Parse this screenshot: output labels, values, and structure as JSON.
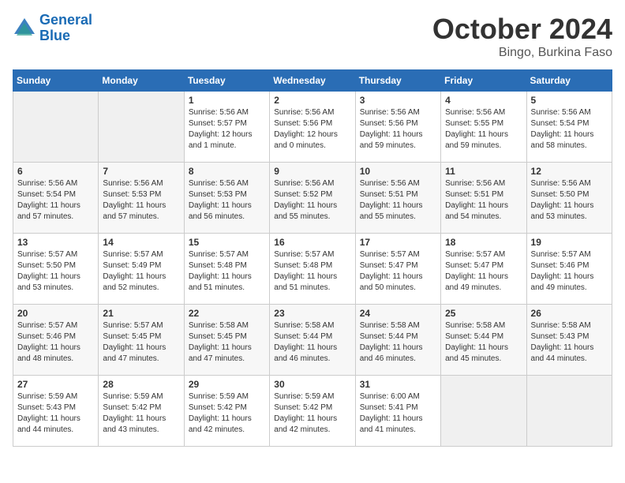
{
  "header": {
    "logo_line1": "General",
    "logo_line2": "Blue",
    "month": "October 2024",
    "location": "Bingo, Burkina Faso"
  },
  "weekdays": [
    "Sunday",
    "Monday",
    "Tuesday",
    "Wednesday",
    "Thursday",
    "Friday",
    "Saturday"
  ],
  "weeks": [
    [
      {
        "day": "",
        "info": ""
      },
      {
        "day": "",
        "info": ""
      },
      {
        "day": "1",
        "info": "Sunrise: 5:56 AM\nSunset: 5:57 PM\nDaylight: 12 hours\nand 1 minute."
      },
      {
        "day": "2",
        "info": "Sunrise: 5:56 AM\nSunset: 5:56 PM\nDaylight: 12 hours\nand 0 minutes."
      },
      {
        "day": "3",
        "info": "Sunrise: 5:56 AM\nSunset: 5:56 PM\nDaylight: 11 hours\nand 59 minutes."
      },
      {
        "day": "4",
        "info": "Sunrise: 5:56 AM\nSunset: 5:55 PM\nDaylight: 11 hours\nand 59 minutes."
      },
      {
        "day": "5",
        "info": "Sunrise: 5:56 AM\nSunset: 5:54 PM\nDaylight: 11 hours\nand 58 minutes."
      }
    ],
    [
      {
        "day": "6",
        "info": "Sunrise: 5:56 AM\nSunset: 5:54 PM\nDaylight: 11 hours\nand 57 minutes."
      },
      {
        "day": "7",
        "info": "Sunrise: 5:56 AM\nSunset: 5:53 PM\nDaylight: 11 hours\nand 57 minutes."
      },
      {
        "day": "8",
        "info": "Sunrise: 5:56 AM\nSunset: 5:53 PM\nDaylight: 11 hours\nand 56 minutes."
      },
      {
        "day": "9",
        "info": "Sunrise: 5:56 AM\nSunset: 5:52 PM\nDaylight: 11 hours\nand 55 minutes."
      },
      {
        "day": "10",
        "info": "Sunrise: 5:56 AM\nSunset: 5:51 PM\nDaylight: 11 hours\nand 55 minutes."
      },
      {
        "day": "11",
        "info": "Sunrise: 5:56 AM\nSunset: 5:51 PM\nDaylight: 11 hours\nand 54 minutes."
      },
      {
        "day": "12",
        "info": "Sunrise: 5:56 AM\nSunset: 5:50 PM\nDaylight: 11 hours\nand 53 minutes."
      }
    ],
    [
      {
        "day": "13",
        "info": "Sunrise: 5:57 AM\nSunset: 5:50 PM\nDaylight: 11 hours\nand 53 minutes."
      },
      {
        "day": "14",
        "info": "Sunrise: 5:57 AM\nSunset: 5:49 PM\nDaylight: 11 hours\nand 52 minutes."
      },
      {
        "day": "15",
        "info": "Sunrise: 5:57 AM\nSunset: 5:48 PM\nDaylight: 11 hours\nand 51 minutes."
      },
      {
        "day": "16",
        "info": "Sunrise: 5:57 AM\nSunset: 5:48 PM\nDaylight: 11 hours\nand 51 minutes."
      },
      {
        "day": "17",
        "info": "Sunrise: 5:57 AM\nSunset: 5:47 PM\nDaylight: 11 hours\nand 50 minutes."
      },
      {
        "day": "18",
        "info": "Sunrise: 5:57 AM\nSunset: 5:47 PM\nDaylight: 11 hours\nand 49 minutes."
      },
      {
        "day": "19",
        "info": "Sunrise: 5:57 AM\nSunset: 5:46 PM\nDaylight: 11 hours\nand 49 minutes."
      }
    ],
    [
      {
        "day": "20",
        "info": "Sunrise: 5:57 AM\nSunset: 5:46 PM\nDaylight: 11 hours\nand 48 minutes."
      },
      {
        "day": "21",
        "info": "Sunrise: 5:57 AM\nSunset: 5:45 PM\nDaylight: 11 hours\nand 47 minutes."
      },
      {
        "day": "22",
        "info": "Sunrise: 5:58 AM\nSunset: 5:45 PM\nDaylight: 11 hours\nand 47 minutes."
      },
      {
        "day": "23",
        "info": "Sunrise: 5:58 AM\nSunset: 5:44 PM\nDaylight: 11 hours\nand 46 minutes."
      },
      {
        "day": "24",
        "info": "Sunrise: 5:58 AM\nSunset: 5:44 PM\nDaylight: 11 hours\nand 46 minutes."
      },
      {
        "day": "25",
        "info": "Sunrise: 5:58 AM\nSunset: 5:44 PM\nDaylight: 11 hours\nand 45 minutes."
      },
      {
        "day": "26",
        "info": "Sunrise: 5:58 AM\nSunset: 5:43 PM\nDaylight: 11 hours\nand 44 minutes."
      }
    ],
    [
      {
        "day": "27",
        "info": "Sunrise: 5:59 AM\nSunset: 5:43 PM\nDaylight: 11 hours\nand 44 minutes."
      },
      {
        "day": "28",
        "info": "Sunrise: 5:59 AM\nSunset: 5:42 PM\nDaylight: 11 hours\nand 43 minutes."
      },
      {
        "day": "29",
        "info": "Sunrise: 5:59 AM\nSunset: 5:42 PM\nDaylight: 11 hours\nand 42 minutes."
      },
      {
        "day": "30",
        "info": "Sunrise: 5:59 AM\nSunset: 5:42 PM\nDaylight: 11 hours\nand 42 minutes."
      },
      {
        "day": "31",
        "info": "Sunrise: 6:00 AM\nSunset: 5:41 PM\nDaylight: 11 hours\nand 41 minutes."
      },
      {
        "day": "",
        "info": ""
      },
      {
        "day": "",
        "info": ""
      }
    ]
  ]
}
